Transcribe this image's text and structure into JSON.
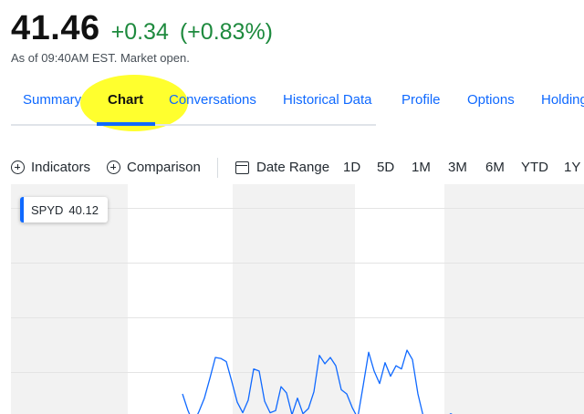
{
  "quote": {
    "price": "41.46",
    "change": "+0.34",
    "change_pct": "(+0.83%)",
    "as_of": "As of 09:40AM EST. Market open."
  },
  "tabs": [
    {
      "label": "Summary",
      "active": false
    },
    {
      "label": "Chart",
      "active": true
    },
    {
      "label": "Conversations",
      "active": false
    },
    {
      "label": "Historical Data",
      "active": false
    },
    {
      "label": "Profile",
      "active": false
    },
    {
      "label": "Options",
      "active": false
    },
    {
      "label": "Holdings",
      "active": false
    }
  ],
  "toolbar": {
    "indicators": "Indicators",
    "comparison": "Comparison",
    "date_range": "Date Range",
    "ranges": [
      "1D",
      "5D",
      "1M",
      "3M",
      "6M",
      "YTD",
      "1Y"
    ]
  },
  "chart": {
    "symbol": "SPYD",
    "value": "40.12",
    "series": [
      40.78,
      40.62,
      40.5,
      40.61,
      40.74,
      40.93,
      41.13,
      41.12,
      41.09,
      40.9,
      40.7,
      40.6,
      40.72,
      41.02,
      41.0,
      40.71,
      40.6,
      40.62,
      40.85,
      40.79,
      40.58,
      40.74,
      40.59,
      40.64,
      40.8,
      41.15,
      41.07,
      41.13,
      41.05,
      40.82,
      40.78,
      40.65,
      40.55,
      40.86,
      41.18,
      41.0,
      40.88,
      41.08,
      40.95,
      41.05,
      41.02,
      41.2,
      41.11,
      40.78,
      40.56,
      40.58,
      40.54,
      40.51,
      40.55,
      40.59,
      40.56
    ]
  },
  "colors": {
    "accent": "#0f69ff",
    "positive": "#1e8a3e",
    "highlight": "#ffff2e"
  }
}
